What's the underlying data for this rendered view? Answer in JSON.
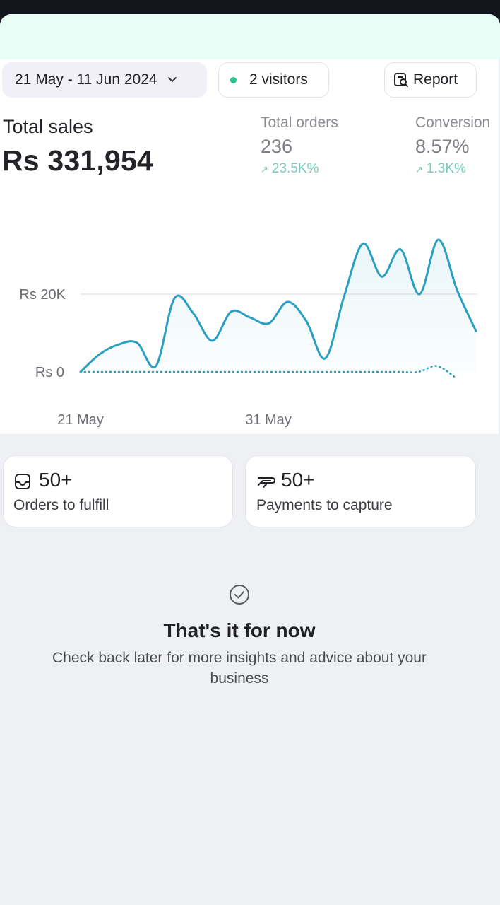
{
  "header": {
    "date_range": "21 May - 11 Jun 2024",
    "visitors": "2 visitors",
    "report_label": "Report"
  },
  "metrics": {
    "total_sales_label": "Total sales",
    "total_sales_value": "Rs 331,954",
    "total_orders_label": "Total orders",
    "total_orders_value": "236",
    "total_orders_delta": "23.5K%",
    "conversion_label": "Conversion",
    "conversion_value": "8.57%",
    "conversion_delta": "1.3K%"
  },
  "colors": {
    "line": "#2a9fc2",
    "accent_green": "#29c08f",
    "delta_text": "#78cbbb"
  },
  "chart_data": {
    "type": "line",
    "x_tick_labels": [
      "21 May",
      "31 May"
    ],
    "y_tick_labels": [
      "Rs 0",
      "Rs 20K"
    ],
    "ylim": [
      0,
      35000
    ],
    "series": [
      {
        "values": [
          0,
          4500,
          7000,
          7500,
          1500,
          19000,
          15000,
          8000,
          15500,
          14000,
          12500,
          18000,
          13000,
          3500,
          19500,
          33000,
          24500,
          31500,
          20000,
          34000,
          21000,
          10500
        ]
      },
      {
        "values": [
          0,
          0,
          0,
          0,
          0,
          0,
          0,
          0,
          0,
          0,
          0,
          0,
          0,
          0,
          0,
          0,
          0,
          0,
          0,
          1500,
          -1500
        ]
      }
    ]
  },
  "cards": {
    "orders_count": "50+",
    "orders_label": "Orders to fulfill",
    "payments_count": "50+",
    "payments_label": "Payments to capture"
  },
  "empty_state": {
    "title": "That's it for now",
    "text": "Check back later for more insights and advice about your business"
  },
  "icons": [
    "chevron-down-icon",
    "report-icon",
    "inbox-icon",
    "payment-icon",
    "check-circle-icon"
  ]
}
